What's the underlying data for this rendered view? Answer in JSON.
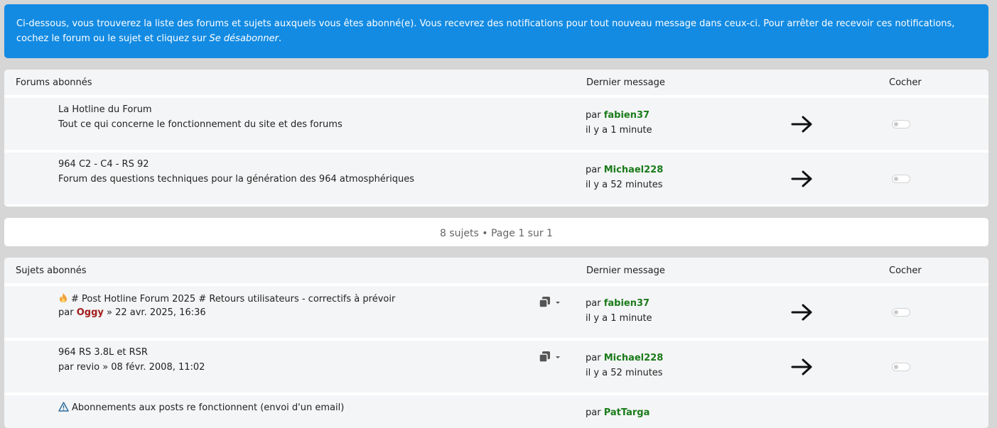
{
  "notice": {
    "text": "Ci-dessous, vous trouverez la liste des forums et sujets auxquels vous êtes abonné(e). Vous recevrez des notifications pour tout nouveau message dans ceux-ci. Pour arrêter de recevoir ces notifications, cochez le forum ou le sujet et cliquez sur ",
    "action": "Se désabonner",
    "end": "."
  },
  "forums": {
    "header_title": "Forums abonnés",
    "header_last": "Dernier message",
    "header_check": "Cocher",
    "rows": [
      {
        "title": "La Hotline du Forum",
        "desc": "Tout ce qui concerne le fonctionnement du site et des forums",
        "by": "par",
        "user": "fabien37",
        "time": "il y a 1 minute"
      },
      {
        "title": "964 C2 - C4 - RS 92",
        "desc": "Forum des questions techniques pour la génération des 964 atmosphériques",
        "by": "par",
        "user": "Michael228",
        "time": "il y a 52 minutes"
      }
    ]
  },
  "pagination": {
    "text": "8 sujets • Page 1 sur 1"
  },
  "topics": {
    "header_title": "Sujets abonnés",
    "header_last": "Dernier message",
    "header_check": "Cocher",
    "rows": [
      {
        "title": "# Post Hotline Forum 2025 # Retours utilisateurs - correctifs à prévoir",
        "by": "par",
        "author": "Oggy",
        "date": "» 22 avr. 2025, 16:36",
        "last_by": "par",
        "last_user": "fabien37",
        "time": "il y a 1 minute"
      },
      {
        "title": "964 RS 3.8L et RSR",
        "by": "par",
        "author": "revio",
        "date": "» 08 févr. 2008, 11:02",
        "last_by": "par",
        "last_user": "Michael228",
        "time": "il y a 52 minutes"
      },
      {
        "title": "Abonnements aux posts re fonctionnent (envoi d'un email)",
        "last_by": "par",
        "last_user": "PatTarga"
      }
    ]
  },
  "colors": {
    "notice_bg": "#138be3",
    "user_green": "#1b7b1b",
    "user_red": "#a11d1d"
  }
}
